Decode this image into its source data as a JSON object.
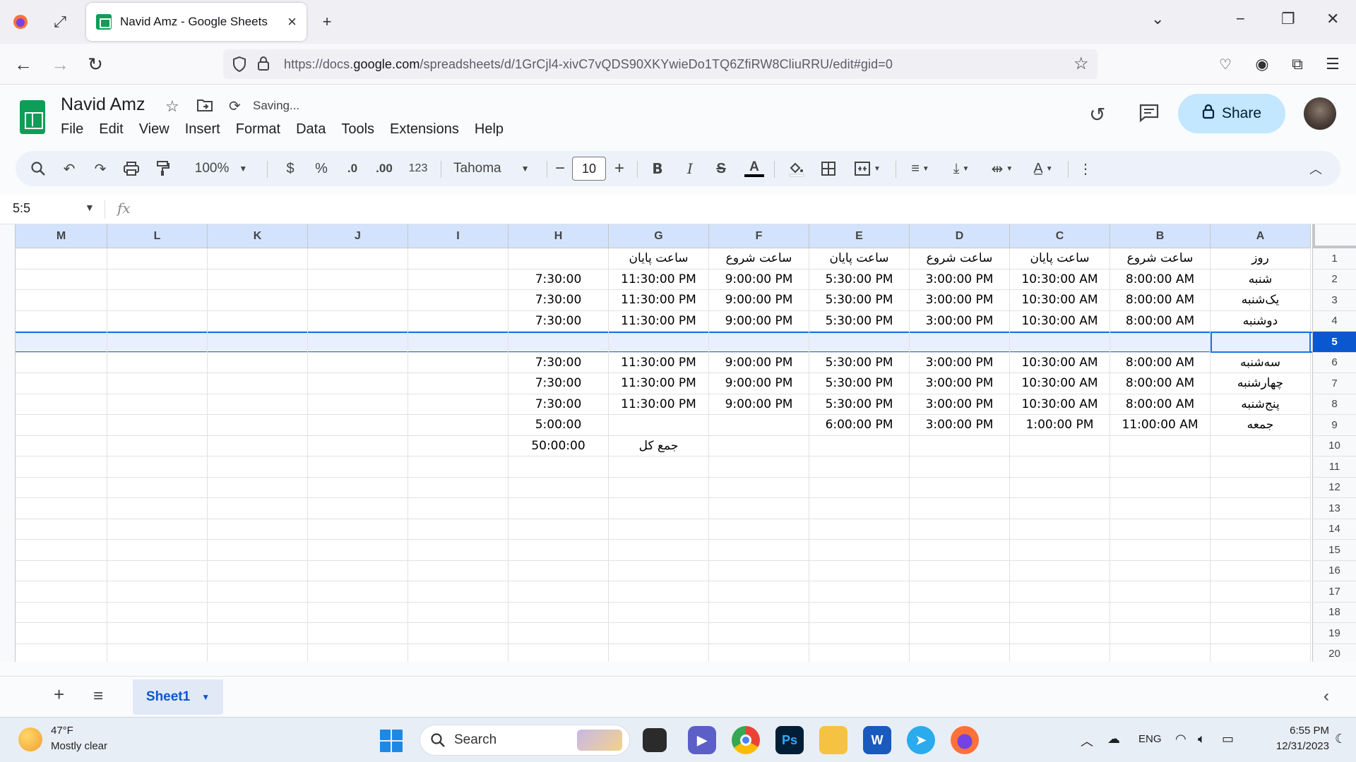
{
  "browser": {
    "tab_title": "Navid Amz - Google Sheets",
    "url_prefix": "https://docs.",
    "url_domain": "google.com",
    "url_rest": "/spreadsheets/d/1GrCjl4-xivC7vQDS90XKYwieDo1TQ6ZfiRW8CliuRRU/edit#gid=0"
  },
  "doc": {
    "title": "Navid Amz",
    "status": "Saving...",
    "menu": [
      "File",
      "Edit",
      "View",
      "Insert",
      "Format",
      "Data",
      "Tools",
      "Extensions",
      "Help"
    ],
    "share_label": "Share"
  },
  "toolbar": {
    "zoom": "100%",
    "currency": "$",
    "percent": "%",
    "dec_decrease": ".0",
    "dec_increase": ".00",
    "number_format": "123",
    "font": "Tahoma",
    "font_size": "10",
    "bold": "B",
    "italic": "I"
  },
  "formula": {
    "name_box": "5:5",
    "fx": "fx"
  },
  "grid": {
    "columns": [
      "M",
      "L",
      "K",
      "J",
      "I",
      "H",
      "G",
      "F",
      "E",
      "D",
      "C",
      "B",
      "A"
    ],
    "row_numbers": [
      "1",
      "2",
      "3",
      "4",
      "5",
      "6",
      "7",
      "8",
      "9",
      "10",
      "11",
      "12",
      "13",
      "14",
      "15",
      "16",
      "17",
      "18",
      "19",
      "20"
    ],
    "selected_row": 5,
    "rows": [
      {
        "A": "روز",
        "B": "ساعت شروع",
        "C": "ساعت پایان",
        "D": "ساعت شروع",
        "E": "ساعت پایان",
        "F": "ساعت شروع",
        "G": "ساعت پایان",
        "H": ""
      },
      {
        "A": "شنبه",
        "B": "8:00:00 AM",
        "C": "10:30:00 AM",
        "D": "3:00:00 PM",
        "E": "5:30:00 PM",
        "F": "9:00:00 PM",
        "G": "11:30:00 PM",
        "H": "7:30:00"
      },
      {
        "A": "یک‌شنبه",
        "B": "8:00:00 AM",
        "C": "10:30:00 AM",
        "D": "3:00:00 PM",
        "E": "5:30:00 PM",
        "F": "9:00:00 PM",
        "G": "11:30:00 PM",
        "H": "7:30:00"
      },
      {
        "A": "دوشنبه",
        "B": "8:00:00 AM",
        "C": "10:30:00 AM",
        "D": "3:00:00 PM",
        "E": "5:30:00 PM",
        "F": "9:00:00 PM",
        "G": "11:30:00 PM",
        "H": "7:30:00"
      },
      {
        "A": "",
        "B": "",
        "C": "",
        "D": "",
        "E": "",
        "F": "",
        "G": "",
        "H": ""
      },
      {
        "A": "سه‌شنبه",
        "B": "8:00:00 AM",
        "C": "10:30:00 AM",
        "D": "3:00:00 PM",
        "E": "5:30:00 PM",
        "F": "9:00:00 PM",
        "G": "11:30:00 PM",
        "H": "7:30:00"
      },
      {
        "A": "چهارشنبه",
        "B": "8:00:00 AM",
        "C": "10:30:00 AM",
        "D": "3:00:00 PM",
        "E": "5:30:00 PM",
        "F": "9:00:00 PM",
        "G": "11:30:00 PM",
        "H": "7:30:00"
      },
      {
        "A": "پنج‌شنبه",
        "B": "8:00:00 AM",
        "C": "10:30:00 AM",
        "D": "3:00:00 PM",
        "E": "5:30:00 PM",
        "F": "9:00:00 PM",
        "G": "11:30:00 PM",
        "H": "7:30:00"
      },
      {
        "A": "جمعه",
        "B": "11:00:00 AM",
        "C": "1:00:00 PM",
        "D": "3:00:00 PM",
        "E": "6:00:00 PM",
        "F": "",
        "G": "",
        "H": "5:00:00"
      },
      {
        "A": "",
        "B": "",
        "C": "",
        "D": "",
        "E": "",
        "F": "",
        "G": "جمع کل",
        "H": "50:00:00"
      }
    ]
  },
  "sheets": {
    "active": "Sheet1"
  },
  "taskbar": {
    "weather_temp": "47°F",
    "weather_desc": "Mostly clear",
    "search_label": "Search",
    "lang": "ENG",
    "time": "6:55 PM",
    "date": "12/31/2023"
  },
  "colors": {
    "accent": "#0b57d0",
    "selection": "#1a73e8",
    "sheets_green": "#0f9d58",
    "share_bg": "#c2e7ff"
  }
}
